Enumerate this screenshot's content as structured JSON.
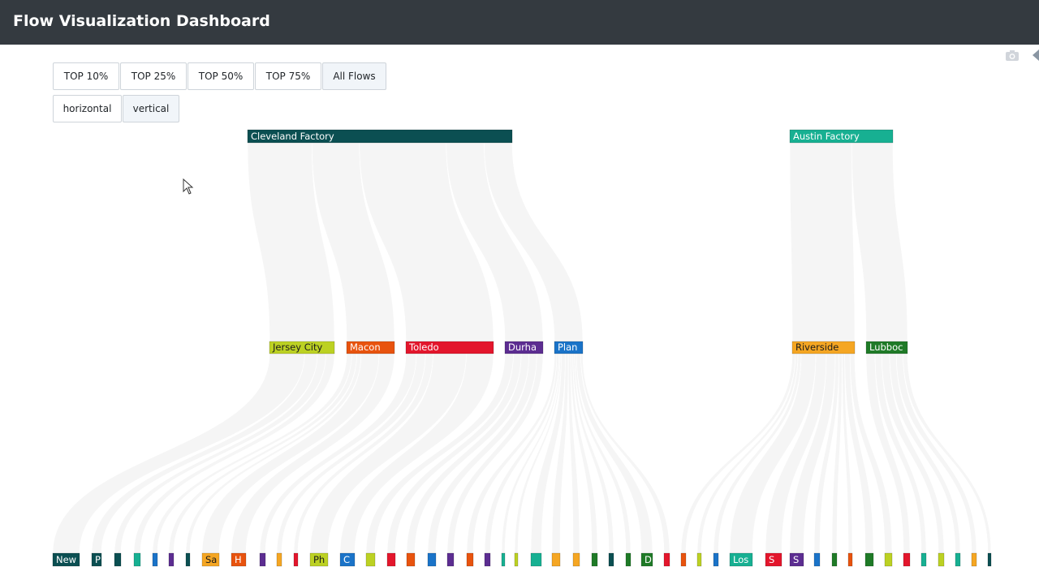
{
  "app": {
    "title": "Flow Visualization Dashboard"
  },
  "filters": [
    {
      "label": "TOP 10%",
      "active": false
    },
    {
      "label": "TOP 25%",
      "active": false
    },
    {
      "label": "TOP 50%",
      "active": false
    },
    {
      "label": "TOP 75%",
      "active": false
    },
    {
      "label": "All Flows",
      "active": true
    }
  ],
  "orientation": [
    {
      "label": "horizontal",
      "active": false
    },
    {
      "label": "vertical",
      "active": true
    }
  ],
  "toolbar": {
    "icons": [
      "camera-icon",
      "arrow-left-icon"
    ]
  },
  "sankey": {
    "link_color": "#ececec",
    "levels": [
      {
        "level": "factory",
        "nodes": [
          {
            "id": "cleveland",
            "label": "Cleveland Factory",
            "color": "#0b4f52"
          },
          {
            "id": "austin",
            "label": "Austin Factory",
            "color": "#17b092"
          }
        ]
      },
      {
        "level": "distribution",
        "nodes": [
          {
            "id": "jersey",
            "label": "Jersey City",
            "color": "#bcd123",
            "parent": "cleveland"
          },
          {
            "id": "macon",
            "label": "Macon",
            "color": "#e8530e",
            "parent": "cleveland"
          },
          {
            "id": "toledo",
            "label": "Toledo",
            "color": "#e3162c",
            "parent": "cleveland"
          },
          {
            "id": "durham",
            "label": "Durha",
            "color": "#5c2d91",
            "parent": "cleveland"
          },
          {
            "id": "plano",
            "label": "Plan",
            "color": "#1a73c8",
            "parent": "cleveland"
          },
          {
            "id": "riverside",
            "label": "Riverside",
            "color": "#f5a623",
            "parent": "austin"
          },
          {
            "id": "lubbock",
            "label": "Lubboc",
            "color": "#1f7a27",
            "parent": "austin"
          }
        ]
      },
      {
        "level": "destination",
        "nodes": [
          {
            "label": "New",
            "color": "#0b4f52"
          },
          {
            "label": "P",
            "color": "#0b4f52"
          },
          {
            "label": "",
            "color": "#0b4f52"
          },
          {
            "label": "",
            "color": "#17b092"
          },
          {
            "label": "",
            "color": "#1a73c8"
          },
          {
            "label": "",
            "color": "#5c2d91"
          },
          {
            "label": "",
            "color": "#0b4f52"
          },
          {
            "label": "Sa",
            "color": "#f5a623"
          },
          {
            "label": "H",
            "color": "#e8530e"
          },
          {
            "label": "",
            "color": "#5c2d91"
          },
          {
            "label": "",
            "color": "#f5a623"
          },
          {
            "label": "",
            "color": "#e3162c"
          },
          {
            "label": "Ph",
            "color": "#bcd123"
          },
          {
            "label": "C",
            "color": "#1a73c8"
          },
          {
            "label": "",
            "color": "#bcd123"
          },
          {
            "label": "",
            "color": "#e3162c"
          },
          {
            "label": "",
            "color": "#e8530e"
          },
          {
            "label": "",
            "color": "#1a73c8"
          },
          {
            "label": "",
            "color": "#5c2d91"
          },
          {
            "label": "",
            "color": "#e8530e"
          },
          {
            "label": "",
            "color": "#5c2d91"
          },
          {
            "label": "",
            "color": "#17b092"
          },
          {
            "label": "",
            "color": "#bcd123"
          },
          {
            "label": "",
            "color": "#17b092"
          },
          {
            "label": "",
            "color": "#f5a623"
          },
          {
            "label": "",
            "color": "#f5a623"
          },
          {
            "label": "",
            "color": "#1f7a27"
          },
          {
            "label": "",
            "color": "#0b4f52"
          },
          {
            "label": "",
            "color": "#1f7a27"
          },
          {
            "label": "D",
            "color": "#1f7a27"
          },
          {
            "label": "",
            "color": "#e3162c"
          },
          {
            "label": "",
            "color": "#e8530e"
          },
          {
            "label": "",
            "color": "#bcd123"
          },
          {
            "label": "",
            "color": "#1a73c8"
          },
          {
            "label": "Los",
            "color": "#17b092"
          },
          {
            "label": "S",
            "color": "#e3162c"
          },
          {
            "label": "S",
            "color": "#5c2d91"
          },
          {
            "label": "",
            "color": "#1a73c8"
          },
          {
            "label": "",
            "color": "#1f7a27"
          },
          {
            "label": "",
            "color": "#e8530e"
          },
          {
            "label": "",
            "color": "#1f7a27"
          },
          {
            "label": "",
            "color": "#bcd123"
          },
          {
            "label": "",
            "color": "#e3162c"
          },
          {
            "label": "",
            "color": "#17b092"
          },
          {
            "label": "",
            "color": "#bcd123"
          },
          {
            "label": "",
            "color": "#17b092"
          },
          {
            "label": "",
            "color": "#f5a623"
          },
          {
            "label": "",
            "color": "#0b4f52"
          }
        ]
      }
    ]
  }
}
